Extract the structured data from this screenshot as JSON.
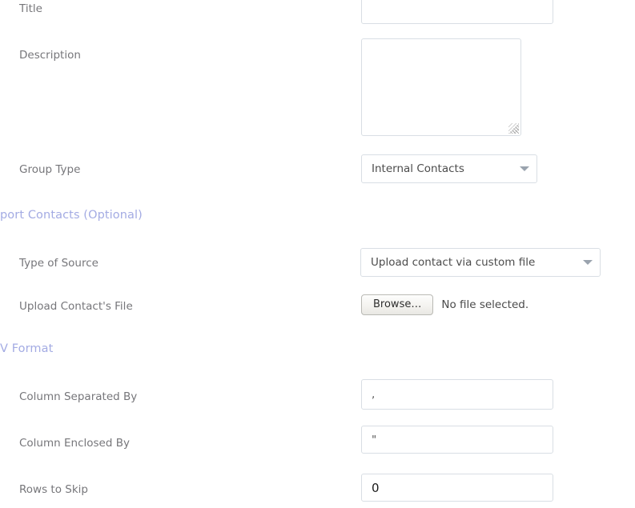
{
  "form": {
    "fields": {
      "title": {
        "label": "Title",
        "value": "",
        "placeholder": ""
      },
      "description": {
        "label": "Description",
        "value": "",
        "placeholder": ""
      },
      "group_type": {
        "label": "Group Type",
        "value": "Internal Contacts",
        "options": [
          "Internal Contacts"
        ],
        "arrow_icon": "chevron-down-icon"
      },
      "type_of_source": {
        "label": "Type of Source",
        "value": "Upload contact via custom file",
        "options": [
          "Upload contact via custom file"
        ],
        "arrow_icon": "chevron-down-icon"
      },
      "upload_file": {
        "label": "Upload Contact's File",
        "browse_label": "Browse…",
        "status": "No file selected."
      },
      "column_separated_by": {
        "label": "Column Separated By",
        "value": ",",
        "placeholder": ""
      },
      "column_enclosed_by": {
        "label": "Column Enclosed By",
        "value": "\"",
        "placeholder": ""
      },
      "rows_to_skip": {
        "label": "Rows to Skip",
        "value": "0",
        "placeholder": ""
      }
    },
    "sections": [
      {
        "id": "import_contacts",
        "heading": "port Contacts (Optional)"
      },
      {
        "id": "csv_format",
        "heading": "V Format"
      }
    ]
  },
  "colors": {
    "section_heading": "#a3abe3",
    "label": "#76767a",
    "input_border": "#d9dee4",
    "value_text": "#3a3a3a",
    "page_background": "#ffffff"
  }
}
